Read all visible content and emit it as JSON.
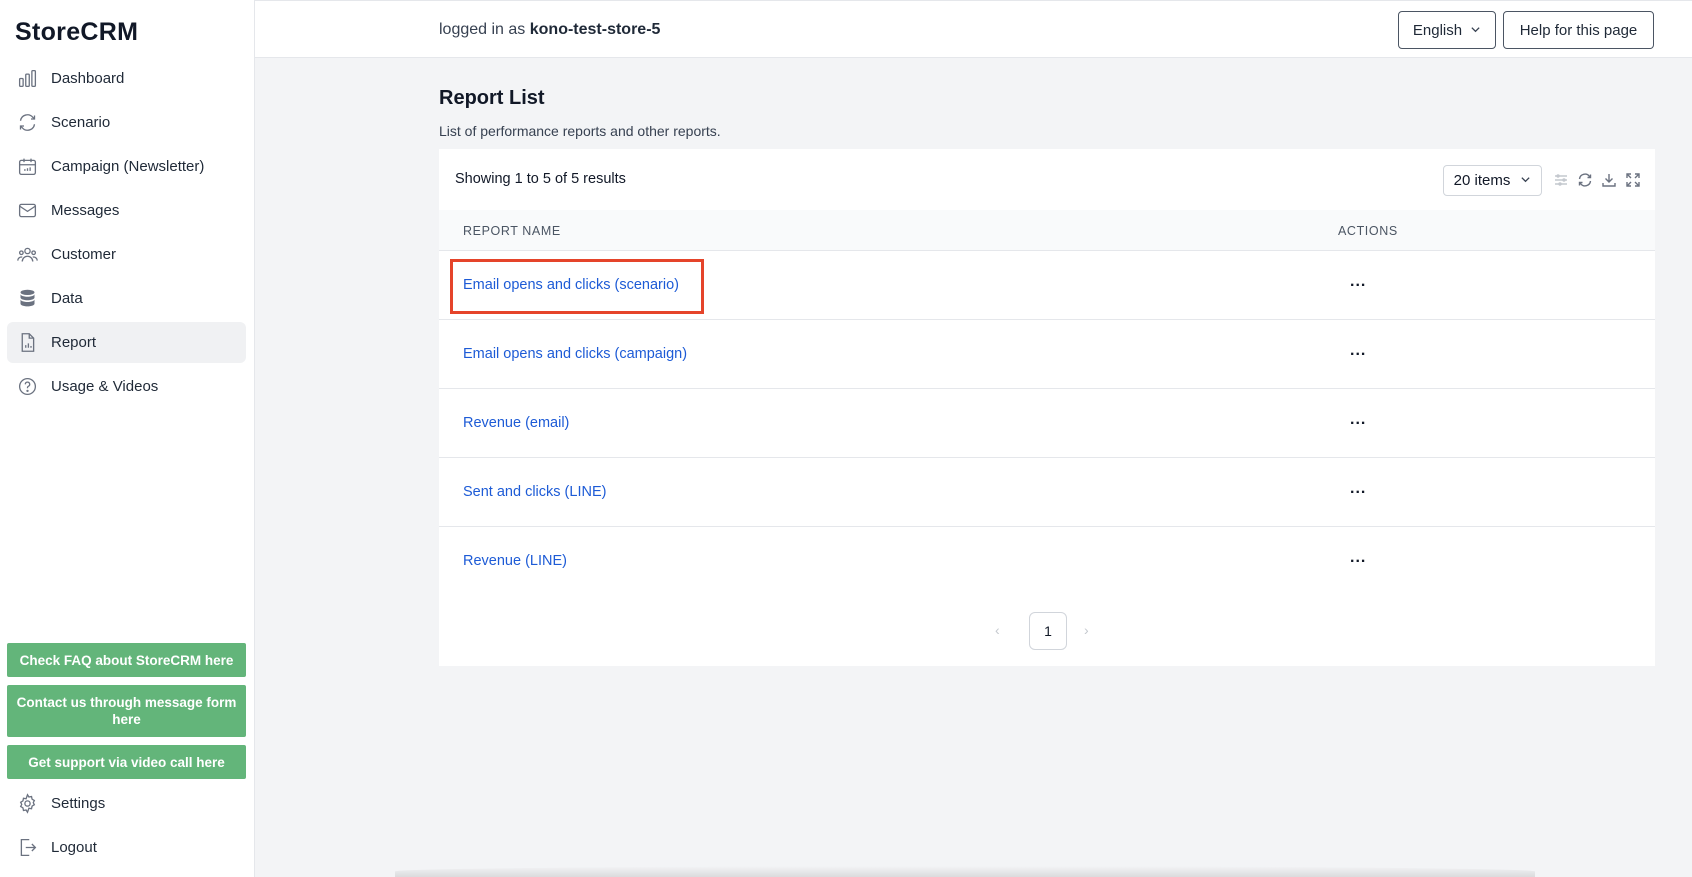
{
  "app": {
    "logo": "StoreCRM"
  },
  "sidebar": {
    "items": [
      {
        "label": "Dashboard",
        "icon": "bar-chart-icon"
      },
      {
        "label": "Scenario",
        "icon": "refresh-icon"
      },
      {
        "label": "Campaign (Newsletter)",
        "icon": "calendar-icon"
      },
      {
        "label": "Messages",
        "icon": "mail-icon"
      },
      {
        "label": "Customer",
        "icon": "users-icon"
      },
      {
        "label": "Data",
        "icon": "database-icon"
      },
      {
        "label": "Report",
        "icon": "report-icon",
        "active": true
      },
      {
        "label": "Usage & Videos",
        "icon": "help-circle-icon"
      }
    ],
    "support_buttons": [
      "Check FAQ about StoreCRM here",
      "Contact us through message form here",
      "Get support via video call here"
    ],
    "bottom_items": [
      {
        "label": "Settings",
        "icon": "gear-icon"
      },
      {
        "label": "Logout",
        "icon": "logout-icon"
      }
    ],
    "support_color": "#63b57a"
  },
  "header": {
    "login_prefix": "logged in as",
    "store_name": "kono-test-store-5",
    "language": "English",
    "help_label": "Help for this page"
  },
  "main": {
    "title": "Report List",
    "subtitle": "List of performance reports and other reports.",
    "showing_text": "Showing 1 to 5 of 5 results",
    "page_size": "20 items",
    "columns": [
      "REPORT NAME",
      "ACTIONS"
    ],
    "rows": [
      {
        "name": "Email opens and clicks (scenario)",
        "actions": "...",
        "highlighted": true
      },
      {
        "name": "Email opens and clicks (campaign)",
        "actions": "..."
      },
      {
        "name": "Revenue (email)",
        "actions": "..."
      },
      {
        "name": "Sent and clicks (LINE)",
        "actions": "..."
      },
      {
        "name": "Revenue (LINE)",
        "actions": "..."
      }
    ],
    "pagination": {
      "current_page": "1"
    },
    "link_color": "#1d5bd6",
    "highlight_color": "#e5442a"
  }
}
